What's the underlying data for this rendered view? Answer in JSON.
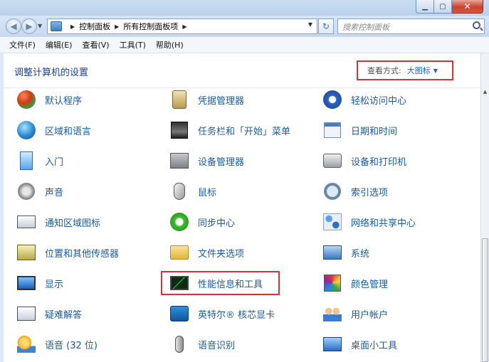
{
  "window": {
    "minimize_label": "▁",
    "maximize_label": "▢",
    "close_label": "✕"
  },
  "nav": {
    "back_label": "◀",
    "forward_label": "▶",
    "breadcrumbs": [
      "控制面板",
      "所有控制面板项"
    ],
    "crumb_separator": "▶",
    "refresh_label": "↻",
    "search_placeholder": "搜索控制面板"
  },
  "menu": {
    "items": [
      "文件(F)",
      "编辑(E)",
      "查看(V)",
      "工具(T)",
      "帮助(H)"
    ]
  },
  "header": {
    "title": "调整计算机的设置",
    "view_by_label": "查看方式:",
    "view_by_value": "大图标",
    "view_by_arrow": "▼"
  },
  "items": {
    "col1": [
      "默认程序",
      "区域和语言",
      "入门",
      "声音",
      "通知区域图标",
      "位置和其他传感器",
      "显示",
      "疑难解答",
      "语音 (32 位)"
    ],
    "col2": [
      "凭据管理器",
      "任务栏和「开始」菜单",
      "设备管理器",
      "鼠标",
      "同步中心",
      "文件夹选项",
      "性能信息和工具",
      "英特尔® 核芯显卡",
      "语音识别"
    ],
    "col3": [
      "轻松访问中心",
      "日期和时间",
      "设备和打印机",
      "索引选项",
      "网络和共享中心",
      "系统",
      "颜色管理",
      "用户帐户",
      "桌面小工具"
    ]
  },
  "icons": {
    "col1": [
      "default-programs-icon",
      "region-language-icon",
      "getting-started-icon",
      "sound-icon",
      "notification-area-icon",
      "location-sensors-icon",
      "display-icon",
      "troubleshooting-icon",
      "speech-icon"
    ],
    "col2": [
      "credential-manager-icon",
      "taskbar-start-icon",
      "device-manager-icon",
      "mouse-icon",
      "sync-center-icon",
      "folder-options-icon",
      "performance-icon",
      "intel-graphics-icon",
      "speech-recognition-icon"
    ],
    "col3": [
      "ease-of-access-icon",
      "date-time-icon",
      "devices-printers-icon",
      "indexing-options-icon",
      "network-sharing-icon",
      "system-icon",
      "color-management-icon",
      "user-accounts-icon",
      "desktop-gadgets-icon"
    ]
  },
  "colors": {
    "link": "#1c5a9a",
    "header": "#1e3f8f",
    "highlight_border": "#d9303a"
  }
}
